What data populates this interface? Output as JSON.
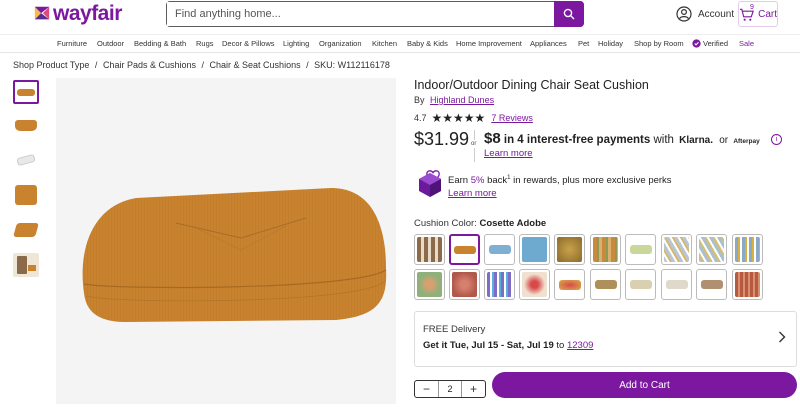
{
  "header": {
    "logo_text": "wayfair",
    "search_placeholder": "Find anything home...",
    "account_label": "Account",
    "cart_label": "Cart",
    "cart_count": "9"
  },
  "nav": {
    "items": [
      "Furniture",
      "Outdoor",
      "Bedding & Bath",
      "Rugs",
      "Decor & Pillows",
      "Lighting",
      "Organization",
      "Kitchen",
      "Baby & Kids",
      "Home Improvement",
      "Appliances",
      "Pet",
      "Holiday",
      "Shop by Room",
      "Verified",
      "Sale"
    ]
  },
  "breadcrumb": {
    "items": [
      "Shop Product Type",
      "Chair Pads & Cushions",
      "Chair & Seat Cushions"
    ],
    "sep": "/",
    "sku": "SKU: W112116178"
  },
  "product": {
    "title": "Indoor/Outdoor Dining Chair Seat Cushion",
    "by": "By",
    "brand": "Highland Dunes",
    "rating": "4.7",
    "stars": "★★★★★",
    "reviews": "7 Reviews",
    "price": "$31.99",
    "or": "or",
    "installment_amount": "$8",
    "installment_text": "in 4 interest-free payments",
    "installment_with": "with",
    "klarna": "Klarna.",
    "or_small": "or",
    "afterpay": "Afterpay",
    "learn_more": "Learn more",
    "reward_earn": "Earn",
    "reward_pct": "5%",
    "reward_back": "back",
    "reward_sup": "1",
    "reward_rest": "in rewards, plus more exclusive perks",
    "learn_more_2": "Learn more",
    "color_label": "Cushion Color:",
    "color_value": "Cosette Adobe"
  },
  "swatches": {
    "colors": [
      "#8b6b4a",
      "#c9832f",
      "#7fb0d4",
      "#6ea9cf",
      "#b08a3a",
      "#c98a3c",
      "#c9d89a",
      "#b8c6d6",
      "#a9c0cf",
      "#8aa8c8",
      "#8fb07a",
      "#b0584a",
      "#7f6cc8",
      "#d9b0a8",
      "#d8b04a",
      "#b0905a",
      "#d8d0b0",
      "#e0d8c8",
      "#b09070",
      "#b85a40"
    ]
  },
  "delivery": {
    "free": "FREE Delivery",
    "get_it": "Get it Tue, Jul 15 - Sat, Jul 19",
    "to": "to",
    "zip": "12309"
  },
  "purchase": {
    "qty": "2",
    "minus": "−",
    "plus": "+",
    "add_to_cart": "Add to Cart"
  },
  "colors": {
    "brand": "#7b189f",
    "cushion": "#c9832f"
  }
}
